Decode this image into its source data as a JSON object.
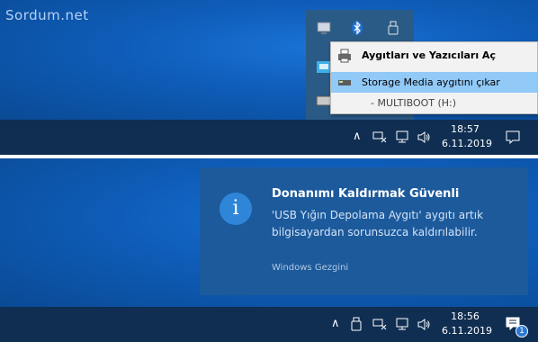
{
  "watermark": "Sordum.net",
  "context_menu": {
    "items": [
      {
        "label": "Aygıtları ve Yazıcıları Aç",
        "icon": "printer-icon"
      },
      {
        "label": "Storage Media aygıtını çıkar",
        "icon": "drive-icon"
      },
      {
        "label": "- MULTIBOOT (H:)"
      }
    ]
  },
  "taskbar_top": {
    "time": "18:57",
    "date": "6.11.2019"
  },
  "toast": {
    "title": "Donanımı Kaldırmak Güvenli",
    "body": "'USB Yığın Depolama Aygıtı' aygıtı artık bilgisayardan sorunsuzca kaldırılabilir.",
    "source": "Windows Gezgini"
  },
  "taskbar_bottom": {
    "time": "18:56",
    "date": "6.11.2019",
    "notification_count": "1"
  },
  "colors": {
    "accent": "#91c9f7",
    "taskbar": "#0f2e52",
    "toast": "#1c5a9c"
  }
}
